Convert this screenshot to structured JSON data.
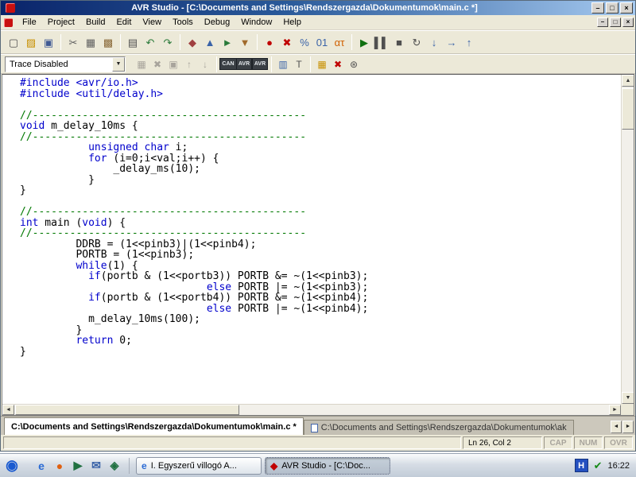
{
  "colors": {
    "chrome": "#ece9d8",
    "titlebar-left": "#0a246a",
    "titlebar-right": "#a6caf0",
    "keyword": "#0000cc",
    "preprocessor": "#0000cc",
    "comment": "#007800"
  },
  "window": {
    "title": "AVR Studio - [C:\\Documents and Settings\\Rendszergazda\\Dokumentumok\\main.c *]",
    "controls": {
      "minimize": "–",
      "maximize": "□",
      "close": "×"
    },
    "mdi_controls": {
      "minimize": "–",
      "restore": "□",
      "close": "×"
    }
  },
  "menu": {
    "items": [
      "File",
      "Project",
      "Build",
      "Edit",
      "View",
      "Tools",
      "Debug",
      "Window",
      "Help"
    ]
  },
  "toolbar_main": {
    "icons": [
      {
        "name": "new-file-icon",
        "glyph": "▢",
        "color": "#505050"
      },
      {
        "name": "open-file-icon",
        "glyph": "▨",
        "color": "#c89000"
      },
      {
        "name": "save-icon",
        "glyph": "▣",
        "color": "#405a94"
      },
      {
        "sep": true
      },
      {
        "name": "cut-icon",
        "glyph": "✂",
        "color": "#606060"
      },
      {
        "name": "copy-icon",
        "glyph": "▦",
        "color": "#606060"
      },
      {
        "name": "paste-icon",
        "glyph": "▩",
        "color": "#8a6a3a"
      },
      {
        "sep": true
      },
      {
        "name": "print-icon",
        "glyph": "▤",
        "color": "#505050"
      },
      {
        "name": "undo-icon",
        "glyph": "↶",
        "color": "#2a7a3a"
      },
      {
        "name": "redo-icon",
        "glyph": "↷",
        "color": "#2a7a3a"
      },
      {
        "sep": true
      },
      {
        "name": "compile-icon",
        "glyph": "◆",
        "color": "#a04040"
      },
      {
        "name": "build-icon",
        "glyph": "▲",
        "color": "#3a63a8"
      },
      {
        "name": "build-and-run-icon",
        "glyph": "►",
        "color": "#2a7a3a"
      },
      {
        "name": "rebuild-all-icon",
        "glyph": "▼",
        "color": "#a06a2a"
      },
      {
        "sep": true
      },
      {
        "name": "toggle-breakpoint-icon",
        "glyph": "●",
        "color": "#c00000"
      },
      {
        "name": "remove-breakpoints-icon",
        "glyph": "✖",
        "color": "#c00000"
      },
      {
        "name": "trace-percent-icon",
        "glyph": "%",
        "color": "#3a63a8"
      },
      {
        "name": "registers-icon",
        "glyph": "01",
        "color": "#3a63a8"
      },
      {
        "name": "alpha-tau-icon",
        "glyph": "ατ",
        "color": "#d06000"
      },
      {
        "sep": true
      },
      {
        "name": "run-icon",
        "glyph": "▶",
        "color": "#107010"
      },
      {
        "name": "pause-icon",
        "glyph": "▌▌",
        "color": "#505050"
      },
      {
        "name": "stop-icon",
        "glyph": "■",
        "color": "#505050"
      },
      {
        "name": "reset-icon",
        "glyph": "↻",
        "color": "#505050"
      },
      {
        "name": "step-into-icon",
        "glyph": "↓",
        "color": "#3a63a8"
      },
      {
        "name": "step-over-icon",
        "glyph": "→",
        "color": "#3a63a8"
      },
      {
        "name": "step-out-icon",
        "glyph": "↑",
        "color": "#3a63a8"
      }
    ]
  },
  "toolbar_trace": {
    "combo_value": "Trace Disabled",
    "combo_arrow": "▼",
    "icons": [
      {
        "name": "trace-open-icon",
        "glyph": "▦",
        "disabled": true
      },
      {
        "name": "trace-clear-icon",
        "glyph": "✖",
        "disabled": true
      },
      {
        "name": "trace-save-icon",
        "glyph": "▣",
        "disabled": true
      },
      {
        "name": "trace-up-icon",
        "glyph": "↑",
        "disabled": true
      },
      {
        "name": "trace-down-icon",
        "glyph": "↓",
        "disabled": true
      },
      {
        "sep": true
      },
      {
        "name": "can-badge-icon",
        "glyph": "CAN",
        "badge": true
      },
      {
        "name": "avr-badge-icon",
        "glyph": "AVR",
        "badge": true
      },
      {
        "name": "avr2-badge-icon",
        "glyph": "AVR",
        "badge": true
      },
      {
        "sep": true
      },
      {
        "name": "stack-view-icon",
        "glyph": "▥",
        "color": "#3a63a8"
      },
      {
        "name": "tag-icon",
        "glyph": "T",
        "color": "#505050"
      },
      {
        "sep": true
      },
      {
        "name": "window-list-icon",
        "glyph": "▦",
        "color": "#c89000"
      },
      {
        "name": "close-all-icon",
        "glyph": "✖",
        "color": "#c00000"
      },
      {
        "name": "options-icon",
        "glyph": "⊛",
        "color": "#505050"
      }
    ]
  },
  "editor": {
    "scrollbar": {
      "up": "▲",
      "down": "▼",
      "left": "◄",
      "right": "►"
    },
    "lines": [
      [
        [
          "pp",
          "#include <avr/io.h>"
        ]
      ],
      [
        [
          "pp",
          "#include <util/delay.h>"
        ]
      ],
      [],
      [
        [
          "cm",
          "//--------------------------------------------"
        ]
      ],
      [
        [
          "kw",
          "void"
        ],
        [
          "pl",
          " m_delay_10ms {"
        ]
      ],
      [
        [
          "cm",
          "//--------------------------------------------"
        ]
      ],
      [
        [
          "pl",
          "           "
        ],
        [
          "kw",
          "unsigned"
        ],
        [
          "pl",
          " "
        ],
        [
          "kw",
          "char"
        ],
        [
          "pl",
          " i;"
        ]
      ],
      [
        [
          "pl",
          "           "
        ],
        [
          "kw",
          "for"
        ],
        [
          "pl",
          " (i=0;i<val;i++) {"
        ]
      ],
      [
        [
          "pl",
          "               _delay_ms(10);"
        ]
      ],
      [
        [
          "pl",
          "           }"
        ]
      ],
      [
        [
          "pl",
          "}"
        ]
      ],
      [],
      [
        [
          "cm",
          "//--------------------------------------------"
        ]
      ],
      [
        [
          "kw",
          "int"
        ],
        [
          "pl",
          " main ("
        ],
        [
          "kw",
          "void"
        ],
        [
          "pl",
          ") {"
        ]
      ],
      [
        [
          "cm",
          "//--------------------------------------------"
        ]
      ],
      [
        [
          "pl",
          "         DDRB = (1<<pinb3)|(1<<pinb4);"
        ]
      ],
      [
        [
          "pl",
          "         PORTB = (1<<pinb3);"
        ]
      ],
      [
        [
          "pl",
          "         "
        ],
        [
          "kw",
          "while"
        ],
        [
          "pl",
          "(1) {"
        ]
      ],
      [
        [
          "pl",
          "           "
        ],
        [
          "kw",
          "if"
        ],
        [
          "pl",
          "(portb & (1<<portb3)) PORTB &= ~(1<<pinb3);"
        ]
      ],
      [
        [
          "pl",
          "                              "
        ],
        [
          "kw",
          "else"
        ],
        [
          "pl",
          " PORTB |= ~(1<<pinb3);"
        ]
      ],
      [
        [
          "pl",
          "           "
        ],
        [
          "kw",
          "if"
        ],
        [
          "pl",
          "(portb & (1<<portb4)) PORTB &= ~(1<<pinb4);"
        ]
      ],
      [
        [
          "pl",
          "                              "
        ],
        [
          "kw",
          "else"
        ],
        [
          "pl",
          " PORTB |= ~(1<<pinb4);"
        ]
      ],
      [
        [
          "pl",
          "           m_delay_10ms(100);"
        ]
      ],
      [
        [
          "pl",
          "         }"
        ]
      ],
      [
        [
          "pl",
          "         "
        ],
        [
          "kw",
          "return"
        ],
        [
          "pl",
          " 0;"
        ]
      ],
      [
        [
          "pl",
          "}"
        ]
      ]
    ]
  },
  "tab_bar": {
    "tabs": [
      {
        "label": "C:\\Documents and Settings\\Rendszergazda\\Dokumentumok\\main.c *",
        "active": true,
        "has_icon": false
      },
      {
        "label": "C:\\Documents and Settings\\Rendszergazda\\Dokumentumok\\ak",
        "active": false,
        "has_icon": true
      }
    ],
    "scroll_left": "◄",
    "scroll_right": "►"
  },
  "status_bar": {
    "cursor": "Ln 26, Col 2",
    "indicators": [
      "CAP",
      "NUM",
      "OVR"
    ]
  },
  "taskbar": {
    "quick_launch": [
      {
        "name": "launcher-icon",
        "glyph": "◉",
        "color": "#1a5ad0"
      },
      {
        "name": "internet-explorer-icon",
        "glyph": "e",
        "color": "#2a6ad4"
      },
      {
        "name": "firefox-icon",
        "glyph": "●",
        "color": "#e06010"
      },
      {
        "name": "media-player-icon",
        "glyph": "▶",
        "color": "#207040"
      },
      {
        "name": "mail-icon",
        "glyph": "✉",
        "color": "#3a63a8"
      },
      {
        "name": "desktop-icon",
        "glyph": "◈",
        "color": "#207040"
      }
    ],
    "tasks": [
      {
        "label": "I. Egyszerű villogó A...",
        "active": false,
        "icon_name": "webpage-icon",
        "icon_glyph": "e",
        "icon_color": "#2a6ad4"
      },
      {
        "label": "AVR Studio - [C:\\Doc...",
        "active": true,
        "icon_name": "avr-studio-icon",
        "icon_glyph": "◆",
        "icon_color": "#c00000"
      }
    ],
    "tray": {
      "language": "H",
      "icon_glyph": "✔",
      "time": "16:22"
    }
  }
}
